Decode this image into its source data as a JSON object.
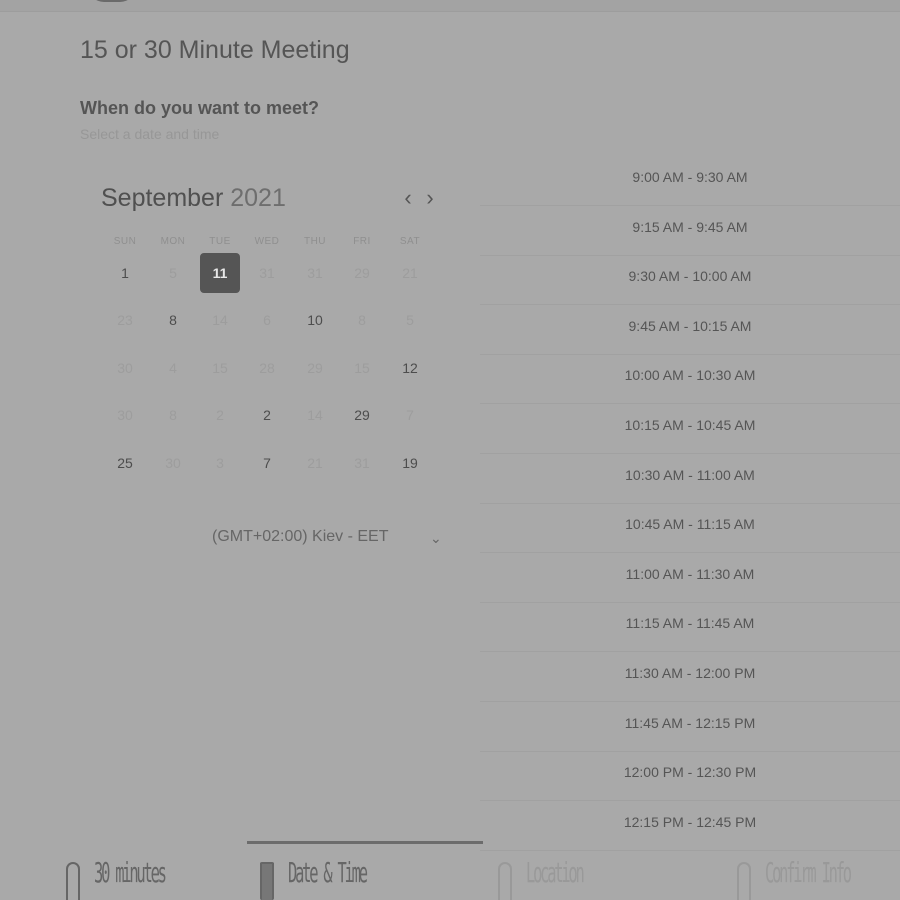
{
  "header": {
    "title": "15 or 30 Minute Meeting",
    "question": "When do you want to meet?",
    "subtitle": "Select a date and time"
  },
  "calendar": {
    "month": "September",
    "year": "2021",
    "prev_icon": "‹",
    "next_icon": "›",
    "weekdays": [
      "SUN",
      "MON",
      "TUE",
      "WED",
      "THU",
      "FRI",
      "SAT"
    ],
    "weeks": [
      [
        {
          "d": "1",
          "m": false
        },
        {
          "d": "5",
          "m": true
        },
        {
          "d": "11",
          "m": false,
          "sel": true
        },
        {
          "d": "31",
          "m": true
        },
        {
          "d": "31",
          "m": true
        },
        {
          "d": "29",
          "m": true
        },
        {
          "d": "21",
          "m": true
        }
      ],
      [
        {
          "d": "23",
          "m": true
        },
        {
          "d": "8",
          "m": false
        },
        {
          "d": "14",
          "m": true
        },
        {
          "d": "6",
          "m": true
        },
        {
          "d": "10",
          "m": false
        },
        {
          "d": "8",
          "m": true
        },
        {
          "d": "5",
          "m": true
        }
      ],
      [
        {
          "d": "30",
          "m": true
        },
        {
          "d": "4",
          "m": true
        },
        {
          "d": "15",
          "m": true
        },
        {
          "d": "28",
          "m": true
        },
        {
          "d": "29",
          "m": true
        },
        {
          "d": "15",
          "m": true
        },
        {
          "d": "12",
          "m": false
        }
      ],
      [
        {
          "d": "30",
          "m": true
        },
        {
          "d": "8",
          "m": true
        },
        {
          "d": "2",
          "m": true
        },
        {
          "d": "2",
          "m": false
        },
        {
          "d": "14",
          "m": true
        },
        {
          "d": "29",
          "m": false
        },
        {
          "d": "7",
          "m": true
        }
      ],
      [
        {
          "d": "25",
          "m": false
        },
        {
          "d": "30",
          "m": true
        },
        {
          "d": "3",
          "m": true
        },
        {
          "d": "7",
          "m": false
        },
        {
          "d": "21",
          "m": true
        },
        {
          "d": "31",
          "m": true
        },
        {
          "d": "19",
          "m": false
        }
      ]
    ]
  },
  "timezone": {
    "label": "(GMT+02:00) Kiev - EET",
    "chevron": "⌄"
  },
  "time_slots": [
    "9:00 AM - 9:30 AM",
    "9:15 AM - 9:45 AM",
    "9:30 AM - 10:00 AM",
    "9:45 AM - 10:15 AM",
    "10:00 AM - 10:30 AM",
    "10:15 AM - 10:45 AM",
    "10:30 AM - 11:00 AM",
    "10:45 AM - 11:15 AM",
    "11:00 AM - 11:30 AM",
    "11:15 AM - 11:45 AM",
    "11:30 AM - 12:00 PM",
    "11:45 AM - 12:15 PM",
    "12:00 PM - 12:30 PM",
    "12:15 PM - 12:45 PM"
  ],
  "steps": [
    {
      "label": "30 minutes",
      "icon": "clock-icon"
    },
    {
      "label": "Date & Time",
      "icon": "calendar-icon"
    },
    {
      "label": "Location",
      "icon": "location-icon"
    },
    {
      "label": "Confirm Info",
      "icon": "checkbox-icon"
    }
  ]
}
